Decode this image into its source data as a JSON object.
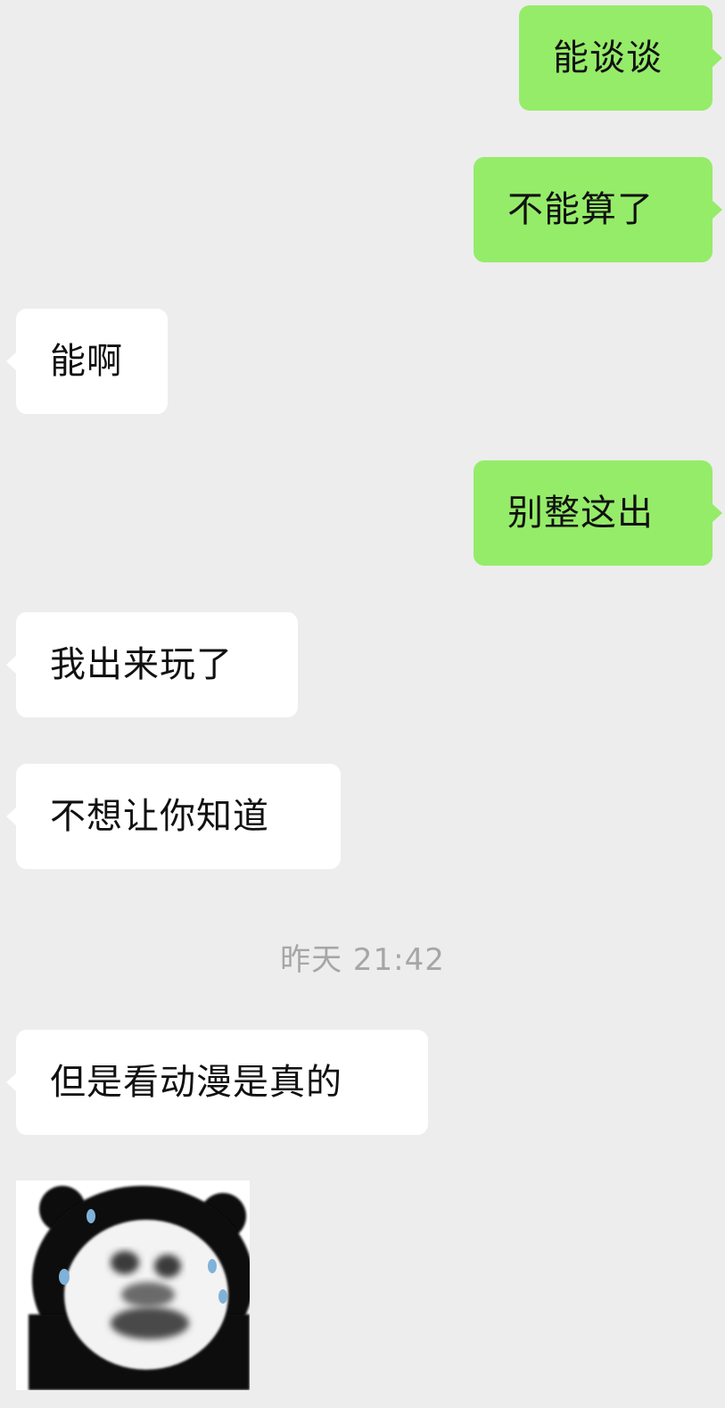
{
  "messages": [
    {
      "side": "sent",
      "text": "能谈谈"
    },
    {
      "side": "sent",
      "text": "不能算了"
    },
    {
      "side": "received",
      "text": "能啊"
    },
    {
      "side": "sent",
      "text": "别整这出"
    },
    {
      "side": "received",
      "text": "我出来玩了"
    },
    {
      "side": "received",
      "text": "不想让你知道"
    },
    {
      "side": "received",
      "text": "但是看动漫是真的"
    }
  ],
  "timestamp": "昨天 21:42",
  "sticker": {
    "icon": "crying-bear-meme-sticker"
  },
  "colors": {
    "background": "#ededed",
    "sent_bubble": "#95ec69",
    "received_bubble": "#ffffff",
    "timestamp_text": "#a6a6a6"
  }
}
